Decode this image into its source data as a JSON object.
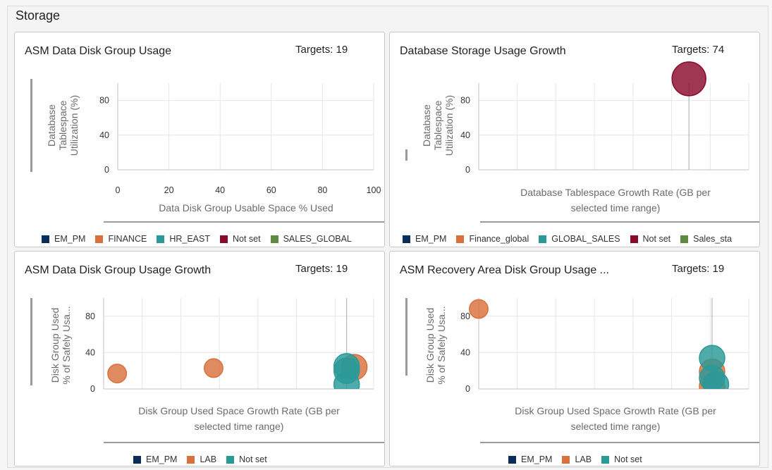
{
  "section": {
    "title": "Storage"
  },
  "cards": [
    {
      "id": "asm-data-usage",
      "title": "ASM Data Disk Group Usage",
      "targets": "Targets: 19",
      "ylabel": [
        "Database",
        "Tablespace",
        "Utilization (%)"
      ],
      "xlabel": [
        "Data Disk Group Usable Space % Used"
      ],
      "legend": [
        {
          "label": "EM_PM",
          "color": "#0b2d5b"
        },
        {
          "label": "FINANCE",
          "color": "#d9703d"
        },
        {
          "label": "HR_EAST",
          "color": "#2a9a98"
        },
        {
          "label": "Not set",
          "color": "#8a0a2c"
        },
        {
          "label": "SALES_GLOBAL",
          "color": "#5f8a43"
        }
      ]
    },
    {
      "id": "db-storage-growth",
      "title": "Database Storage Usage Growth",
      "targets": "Targets: 74",
      "ylabel": [
        "Database",
        "Tablespace",
        "Utilization (%)"
      ],
      "xlabel": [
        "Database Tablespace Growth Rate (GB per",
        "selected time range)"
      ],
      "legend": [
        {
          "label": "EM_PM",
          "color": "#0b2d5b"
        },
        {
          "label": "Finance_global",
          "color": "#d9703d"
        },
        {
          "label": "GLOBAL_SALES",
          "color": "#2a9a98"
        },
        {
          "label": "Not set",
          "color": "#8a0a2c"
        },
        {
          "label": "Sales_sta",
          "color": "#5f8a43"
        }
      ]
    },
    {
      "id": "asm-data-growth",
      "title": "ASM Data Disk Group Usage Growth",
      "targets": "Targets: 19",
      "ylabel": [
        "Disk Group Used",
        "% of Safely Usa..."
      ],
      "xlabel": [
        "Disk Group Used Space Growth Rate (GB per",
        "selected time range)"
      ],
      "legend": [
        {
          "label": "EM_PM",
          "color": "#0b2d5b"
        },
        {
          "label": "LAB",
          "color": "#d9703d"
        },
        {
          "label": "Not set",
          "color": "#2a9a98"
        }
      ]
    },
    {
      "id": "asm-recovery-usage",
      "title": "ASM Recovery Area Disk Group Usage ...",
      "targets": "Targets: 19",
      "ylabel": [
        "Disk Group Used",
        "% of Safely Usa..."
      ],
      "xlabel": [
        "Disk Group Used Space Growth Rate (GB per",
        "selected time range)"
      ],
      "legend": [
        {
          "label": "EM_PM",
          "color": "#0b2d5b"
        },
        {
          "label": "LAB",
          "color": "#d9703d"
        },
        {
          "label": "Not set",
          "color": "#2a9a98"
        }
      ]
    }
  ],
  "chart_data": [
    {
      "type": "scatter",
      "title": "ASM Data Disk Group Usage",
      "xlabel": "Data Disk Group Usable Space % Used",
      "ylabel": "Database Tablespace Utilization (%)",
      "xlim": [
        0,
        100
      ],
      "ylim": [
        0,
        100
      ],
      "xticks": [
        0,
        20,
        40,
        60,
        80,
        100
      ],
      "yticks": [
        0,
        40,
        80
      ],
      "xtick_labels": [
        "0",
        "20",
        "40",
        "60",
        "80",
        "100"
      ],
      "ytick_labels": [
        "0",
        "40",
        "80"
      ],
      "grid": true,
      "legend_position": "bottom",
      "series": []
    },
    {
      "type": "scatter",
      "title": "Database Storage Usage Growth",
      "xlabel": "Database Tablespace Growth Rate (GB per selected time range)",
      "ylabel": "Database Tablespace Utilization (%)",
      "xlim": [
        0,
        7
      ],
      "ylim": [
        0,
        100
      ],
      "yticks": [
        0,
        40,
        80
      ],
      "ytick_labels": [
        "0",
        "40",
        "80"
      ],
      "grid": true,
      "legend_position": "bottom",
      "series": [
        {
          "name": "Not set",
          "color": "#8a0a2c",
          "points": [
            {
              "x": 5.45,
              "y": 105,
              "r": 1.0
            }
          ]
        }
      ]
    },
    {
      "type": "scatter",
      "title": "ASM Data Disk Group Usage Growth",
      "xlabel": "Disk Group Used Space Growth Rate (GB per selected time range)",
      "ylabel": "Disk Group Used % of Safely Usa...",
      "xlim": [
        0,
        7
      ],
      "ylim": [
        0,
        100
      ],
      "yticks": [
        0,
        40,
        80
      ],
      "ytick_labels": [
        "0",
        "40",
        "80"
      ],
      "grid": true,
      "legend_position": "bottom",
      "series": [
        {
          "name": "LAB",
          "color": "#d9703d",
          "points": [
            {
              "x": 0.35,
              "y": 17,
              "r": 0.55
            },
            {
              "x": 2.85,
              "y": 23,
              "r": 0.55
            },
            {
              "x": 6.5,
              "y": 24,
              "r": 0.75
            }
          ]
        },
        {
          "name": "Not set",
          "color": "#2a9a98",
          "points": [
            {
              "x": 6.3,
              "y": 25,
              "r": 0.75
            },
            {
              "x": 6.3,
              "y": 20,
              "r": 0.75
            },
            {
              "x": 6.3,
              "y": 5,
              "r": 0.75
            }
          ]
        }
      ]
    },
    {
      "type": "scatter",
      "title": "ASM Recovery Area Disk Group Usage ...",
      "xlabel": "Disk Group Used Space Growth Rate (GB per selected time range)",
      "ylabel": "Disk Group Used % of Safely Usa...",
      "xlim": [
        0,
        7
      ],
      "ylim": [
        0,
        100
      ],
      "yticks": [
        0,
        40,
        80
      ],
      "ytick_labels": [
        "0",
        "40",
        "80"
      ],
      "grid": true,
      "legend_position": "bottom",
      "series": [
        {
          "name": "LAB",
          "color": "#d9703d",
          "points": [
            {
              "x": 0.0,
              "y": 88,
              "r": 0.55
            },
            {
              "x": 6.05,
              "y": 19,
              "r": 0.75
            },
            {
              "x": 6.05,
              "y": 3,
              "r": 0.75
            }
          ]
        },
        {
          "name": "Not set",
          "color": "#2a9a98",
          "points": [
            {
              "x": 6.05,
              "y": 34,
              "r": 0.75
            },
            {
              "x": 6.05,
              "y": 12,
              "r": 0.75
            },
            {
              "x": 6.15,
              "y": 5,
              "r": 0.75
            }
          ]
        }
      ]
    }
  ]
}
